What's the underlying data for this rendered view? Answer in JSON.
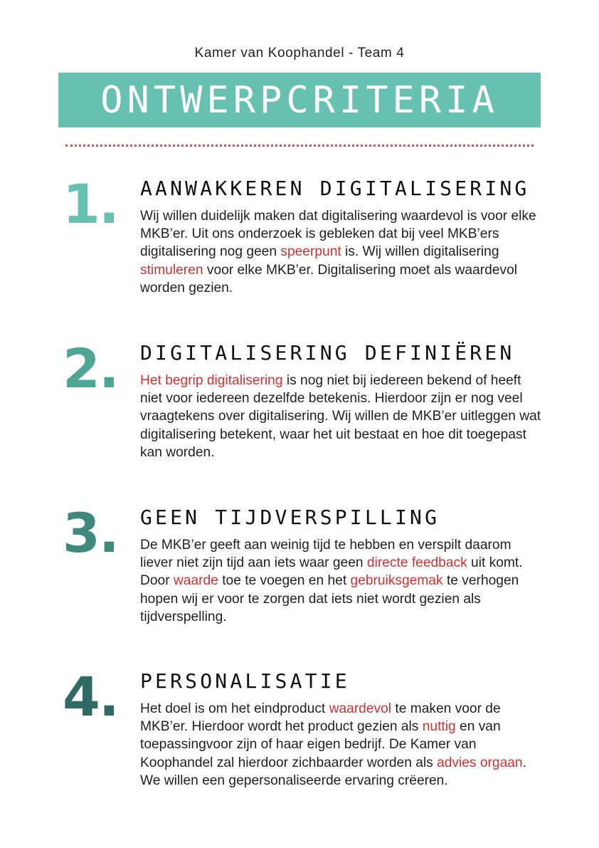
{
  "header": {
    "subtitle": "Kamer van Koophandel - Team 4",
    "title": "ONTWERPCRITERIA"
  },
  "colors": {
    "banner": "#66c1b0",
    "accent_red": "#d32f2f",
    "number_1": "#66c1b0",
    "number_2": "#4fa593",
    "number_3": "#3f8a7c",
    "number_4": "#2f6b62"
  },
  "sections": [
    {
      "number": "1.",
      "heading": "AANWAKKEREN DIGITALISERING",
      "body": [
        {
          "t": "Wij willen duidelijk maken dat digitalisering waardevol is voor elke MKB’er. Uit ons onderzoek is gebleken dat bij veel MKB’ers digitalisering nog geen "
        },
        {
          "t": "speerpunt",
          "hl": true
        },
        {
          "t": " is. Wij willen digitalisering "
        },
        {
          "t": "stimuleren",
          "hl": true
        },
        {
          "t": " voor elke MKB’er. Digitalisering moet als waardevol worden gezien."
        }
      ]
    },
    {
      "number": "2.",
      "heading": "DIGITALISERING DEFINIËREN",
      "body": [
        {
          "t": "Het begrip digitalisering",
          "hl": true
        },
        {
          "t": " is nog niet bij iedereen bekend of heeft niet voor iedereen dezelfde betekenis. Hierdoor zijn er nog veel vraagtekens over digitalisering. Wij willen de MKB’er uitleggen wat digitalisering betekent, waar het uit bestaat en hoe dit toegepast kan worden."
        }
      ]
    },
    {
      "number": "3.",
      "heading": "GEEN TIJDVERSPILLING",
      "body": [
        {
          "t": "De MKB’er geeft aan weinig tijd te hebben en verspilt daarom liever niet zijn tijd aan iets waar geen "
        },
        {
          "t": "directe feedback",
          "hl": true
        },
        {
          "t": " uit komt. Door "
        },
        {
          "t": "waarde",
          "hl": true
        },
        {
          "t": " toe te voegen en het "
        },
        {
          "t": "gebruiksgemak",
          "hl": true
        },
        {
          "t": " te verhogen hopen wij er voor te zorgen dat iets niet wordt gezien als tijdverspelling."
        }
      ]
    },
    {
      "number": "4.",
      "heading": "PERSONALISATIE",
      "body": [
        {
          "t": "Het doel is om het eindproduct "
        },
        {
          "t": "waardevol",
          "hl": true
        },
        {
          "t": " te maken voor de MKB’er. Hierdoor wordt het product gezien als "
        },
        {
          "t": "nuttig",
          "hl": true
        },
        {
          "t": " en van toepassingvoor zijn of haar eigen bedrijf. De Kamer van Koophandel zal hierdoor zichbaarder worden als "
        },
        {
          "t": "advies orgaan",
          "hl": true
        },
        {
          "t": ". We willen een gepersonaliseerde ervaring crëeren."
        }
      ]
    }
  ]
}
